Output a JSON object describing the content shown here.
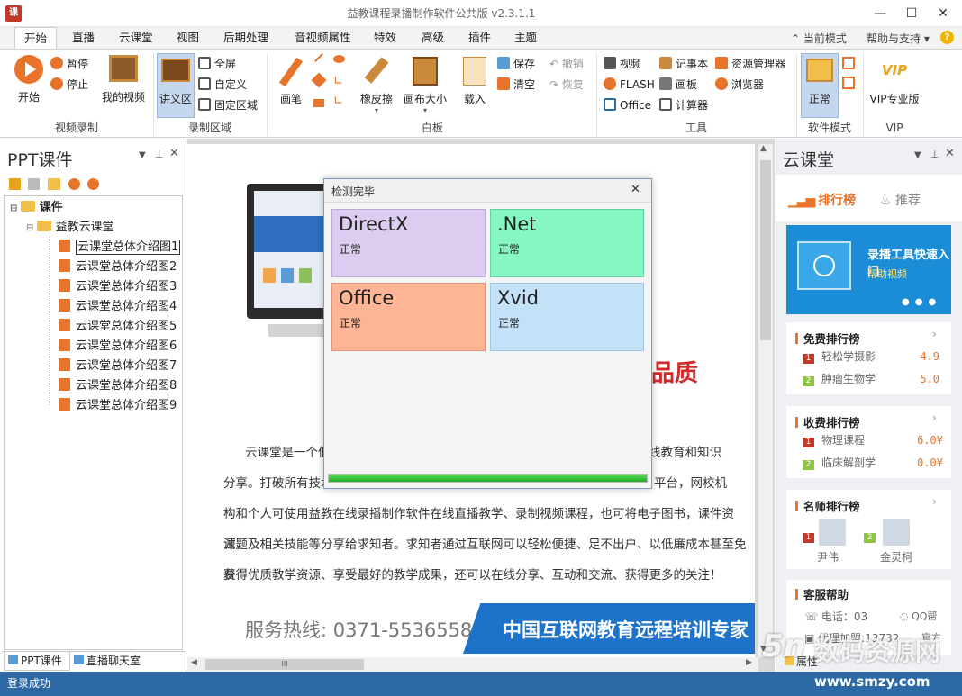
{
  "window": {
    "title": "益教课程录播制作软件公共版 v2.3.1.1",
    "app_icon_text": "课"
  },
  "menu": {
    "tabs": [
      "开始",
      "直播",
      "云课堂",
      "视图",
      "后期处理",
      "音视频属性",
      "特效",
      "高级",
      "插件",
      "主题"
    ],
    "right_items": {
      "mode": "当前模式",
      "help": "帮助与支持"
    }
  },
  "ribbon": {
    "video_record": {
      "start": "开始",
      "pause": "暂停",
      "stop": "停止",
      "my_video": "我的视频",
      "group": "视频录制"
    },
    "record_area": {
      "lecture": "讲义区",
      "fullscreen": "全屏",
      "custom": "自定义",
      "fixed": "固定区域",
      "group": "录制区域"
    },
    "whiteboard": {
      "pen": "画笔",
      "eraser": "橡皮擦",
      "canvas_size": "画布大小",
      "load": "载入",
      "save": "保存",
      "clear": "清空",
      "undo": "撤销",
      "redo": "恢复",
      "group": "白板"
    },
    "tools": {
      "video": "视频",
      "flash": "FLASH",
      "office": "Office",
      "notepad": "记事本",
      "drawing": "画板",
      "calc": "计算器",
      "explorer": "资源管理器",
      "browser": "浏览器",
      "group": "工具"
    },
    "mode": {
      "normal": "正常",
      "group": "软件模式"
    },
    "vip": {
      "pro": "VIP专业版",
      "badge": "VIP",
      "group": "VIP"
    }
  },
  "left_panel": {
    "title": "PPT课件",
    "tree": {
      "root": "课件",
      "folder": "益教云课堂",
      "items": [
        "云课堂总体介绍图1",
        "云课堂总体介绍图2",
        "云课堂总体介绍图3",
        "云课堂总体介绍图4",
        "云课堂总体介绍图5",
        "云课堂总体介绍图6",
        "云课堂总体介绍图7",
        "云课堂总体介绍图8",
        "云课堂总体介绍图9"
      ]
    },
    "bottom_tabs": [
      "PPT课件",
      "直播聊天室"
    ]
  },
  "document": {
    "headline_fragment": "品质",
    "paragraph_lines": [
      "云课堂是一个低",
      "线教育和知识",
      "分享。打破所有技术",
      "平台，网校机",
      "构和个人可使用益教在线录播制作软件在线直播教学、录制视频课程，也可将电子图书，课件资源，",
      "试题及相关技能等分享给求知者。求知者通过互联网可以轻松便捷、足不出户、以低廉成本甚至免费",
      "获得优质教学资源、享受最好的教学成果，还可以在线分享、互动和交流、获得更多的关注！"
    ],
    "hotline": "服务热线: 0371-55365586",
    "banner": "中国互联网教育远程培训专家",
    "scrollbar_mark": "III"
  },
  "dialog": {
    "title": "检测完毕",
    "tiles": [
      {
        "name": "DirectX",
        "status": "正常",
        "color": "#dccdf0"
      },
      {
        "name": ".Net",
        "status": "正常",
        "color": "#86f7c3"
      },
      {
        "name": "Office",
        "status": "正常",
        "color": "#fdb596"
      },
      {
        "name": "Xvid",
        "status": "正常",
        "color": "#c3e2f8"
      }
    ],
    "progress": 1.0
  },
  "right_panel": {
    "title": "云课堂",
    "tabs": {
      "ranking": "排行榜",
      "recommend": "推荐"
    },
    "banner": {
      "title": "录播工具快速入门",
      "subtitle": "帮助视频"
    },
    "free_rank": {
      "title": "免费排行榜",
      "items": [
        {
          "rank": "1",
          "name": "轻松学摄影",
          "value": "4.9"
        },
        {
          "rank": "2",
          "name": "肿瘤生物学",
          "value": "5.0"
        }
      ]
    },
    "paid_rank": {
      "title": "收费排行榜",
      "items": [
        {
          "rank": "1",
          "name": "物理课程",
          "value": "6.0¥"
        },
        {
          "rank": "2",
          "name": "临床解剖学",
          "value": "0.0¥"
        }
      ]
    },
    "teacher_rank": {
      "title": "名师排行榜",
      "items": [
        {
          "rank": "1",
          "name": "尹伟"
        },
        {
          "rank": "2",
          "name": "金灵柯"
        }
      ]
    },
    "support": {
      "title": "客服帮助",
      "phone": "电话：03",
      "qq": "QQ帮",
      "agent": "代理加盟:13732",
      "official": "官方"
    },
    "bottom_tab": "属性"
  },
  "status": {
    "text": "登录成功"
  },
  "watermark": {
    "text": "数码资源网",
    "url": "www.smzy.com"
  }
}
